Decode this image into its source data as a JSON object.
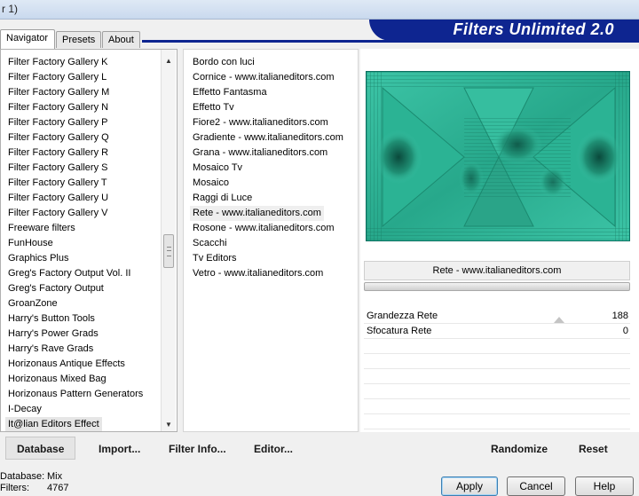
{
  "window": {
    "title_fragment": "r 1)"
  },
  "tabs": [
    {
      "label": "Navigator",
      "active": true
    },
    {
      "label": "Presets",
      "active": false
    },
    {
      "label": "About",
      "active": false
    }
  ],
  "banner": {
    "title": "Filters Unlimited 2.0",
    "color": "#0e2590"
  },
  "categories": {
    "items": [
      "Filter Factory Gallery K",
      "Filter Factory Gallery L",
      "Filter Factory Gallery M",
      "Filter Factory Gallery N",
      "Filter Factory Gallery P",
      "Filter Factory Gallery Q",
      "Filter Factory Gallery R",
      "Filter Factory Gallery S",
      "Filter Factory Gallery T",
      "Filter Factory Gallery U",
      "Filter Factory Gallery V",
      "Freeware filters",
      "FunHouse",
      "Graphics Plus",
      "Greg's Factory Output Vol. II",
      "Greg's Factory Output",
      "GroanZone",
      "Harry's Button Tools",
      "Harry's Power Grads",
      "Harry's Rave Grads",
      "Horizonaus Antique Effects",
      "Horizonaus Mixed Bag",
      "Horizonaus Pattern Generators",
      "I-Decay",
      "It@lian Editors Effect"
    ],
    "selected_index": 24
  },
  "filters": {
    "items": [
      "Bordo con luci",
      "Cornice - www.italianeditors.com",
      "Effetto Fantasma",
      "Effetto Tv",
      "Fiore2 - www.italianeditors.com",
      "Gradiente - www.italianeditors.com",
      "Grana - www.italianeditors.com",
      "Mosaico Tv",
      "Mosaico",
      "Raggi di Luce",
      "Rete - www.italianeditors.com",
      "Rosone - www.italianeditors.com",
      "Scacchi",
      "Tv Editors",
      "Vetro - www.italianeditors.com"
    ],
    "selected_index": 10
  },
  "preview": {
    "base_color": "#2fb89a",
    "dark_color": "#0a5c4c"
  },
  "selected_filter_name": "Rete - www.italianeditors.com",
  "parameters": [
    {
      "label": "Grandezza Rete",
      "value": "188",
      "level": 0.74
    },
    {
      "label": "Sfocatura Rete",
      "value": "0",
      "level": 0
    }
  ],
  "toolbar": {
    "database": "Database",
    "import": "Import...",
    "filter_info": "Filter Info...",
    "editor": "Editor...",
    "randomize": "Randomize",
    "reset": "Reset"
  },
  "status": {
    "database_label": "Database:",
    "database_value": "Mix",
    "filters_label": "Filters:",
    "filters_value": "4767"
  },
  "buttons": {
    "apply": "Apply",
    "cancel": "Cancel",
    "help": "Help"
  }
}
